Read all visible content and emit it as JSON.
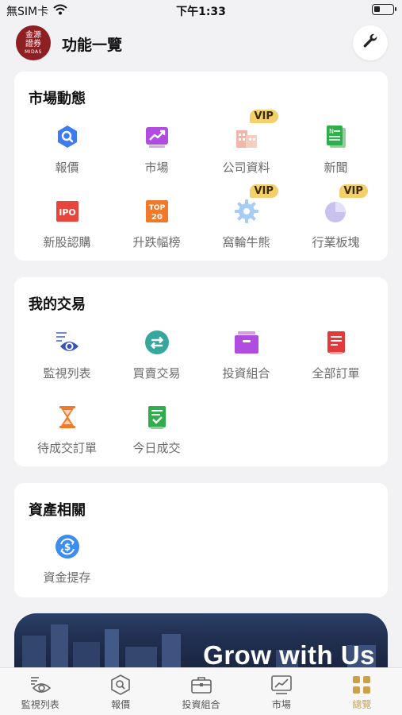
{
  "status_bar": {
    "carrier": "無SIM卡",
    "time": "下午1:33"
  },
  "header": {
    "logo_line1": "金源",
    "logo_line2": "證券",
    "logo_line3": "MIDAS",
    "title": "功能一覽"
  },
  "sections": {
    "market": {
      "title": "市場動態",
      "items": [
        {
          "label": "報價",
          "icon": "quote-search-icon"
        },
        {
          "label": "市場",
          "icon": "market-chart-icon"
        },
        {
          "label": "公司資料",
          "icon": "company-building-icon",
          "badge": "VIP"
        },
        {
          "label": "新聞",
          "icon": "news-icon"
        },
        {
          "label": "新股認購",
          "icon": "ipo-icon",
          "icon_text": "IPO"
        },
        {
          "label": "升跌幅榜",
          "icon": "top20-icon",
          "icon_text1": "TOP",
          "icon_text2": "20"
        },
        {
          "label": "窩輪牛熊",
          "icon": "warrant-gear-icon",
          "badge": "VIP"
        },
        {
          "label": "行業板塊",
          "icon": "sector-pie-icon",
          "badge": "VIP"
        }
      ]
    },
    "trading": {
      "title": "我的交易",
      "items": [
        {
          "label": "監視列表",
          "icon": "watchlist-eye-icon"
        },
        {
          "label": "買賣交易",
          "icon": "trade-arrows-icon"
        },
        {
          "label": "投資組合",
          "icon": "portfolio-box-icon"
        },
        {
          "label": "全部訂單",
          "icon": "all-orders-icon"
        },
        {
          "label": "待成交訂單",
          "icon": "pending-hourglass-icon"
        },
        {
          "label": "今日成交",
          "icon": "today-done-icon"
        }
      ]
    },
    "assets": {
      "title": "資產相關",
      "items": [
        {
          "label": "資金提存",
          "icon": "deposit-withdraw-icon"
        }
      ]
    }
  },
  "banner": {
    "text": "Grow with Us"
  },
  "bottom_nav": {
    "items": [
      {
        "label": "監視列表",
        "icon": "watchlist-eye-icon"
      },
      {
        "label": "報價",
        "icon": "quote-search-icon"
      },
      {
        "label": "投資組合",
        "icon": "briefcase-icon"
      },
      {
        "label": "市場",
        "icon": "market-chart-icon"
      },
      {
        "label": "總覽",
        "icon": "grid-icon",
        "active": true
      }
    ]
  },
  "colors": {
    "accent_gold": "#c9a24a",
    "vip_badge": "#f4d06b",
    "logo_red": "#8e1f23"
  }
}
